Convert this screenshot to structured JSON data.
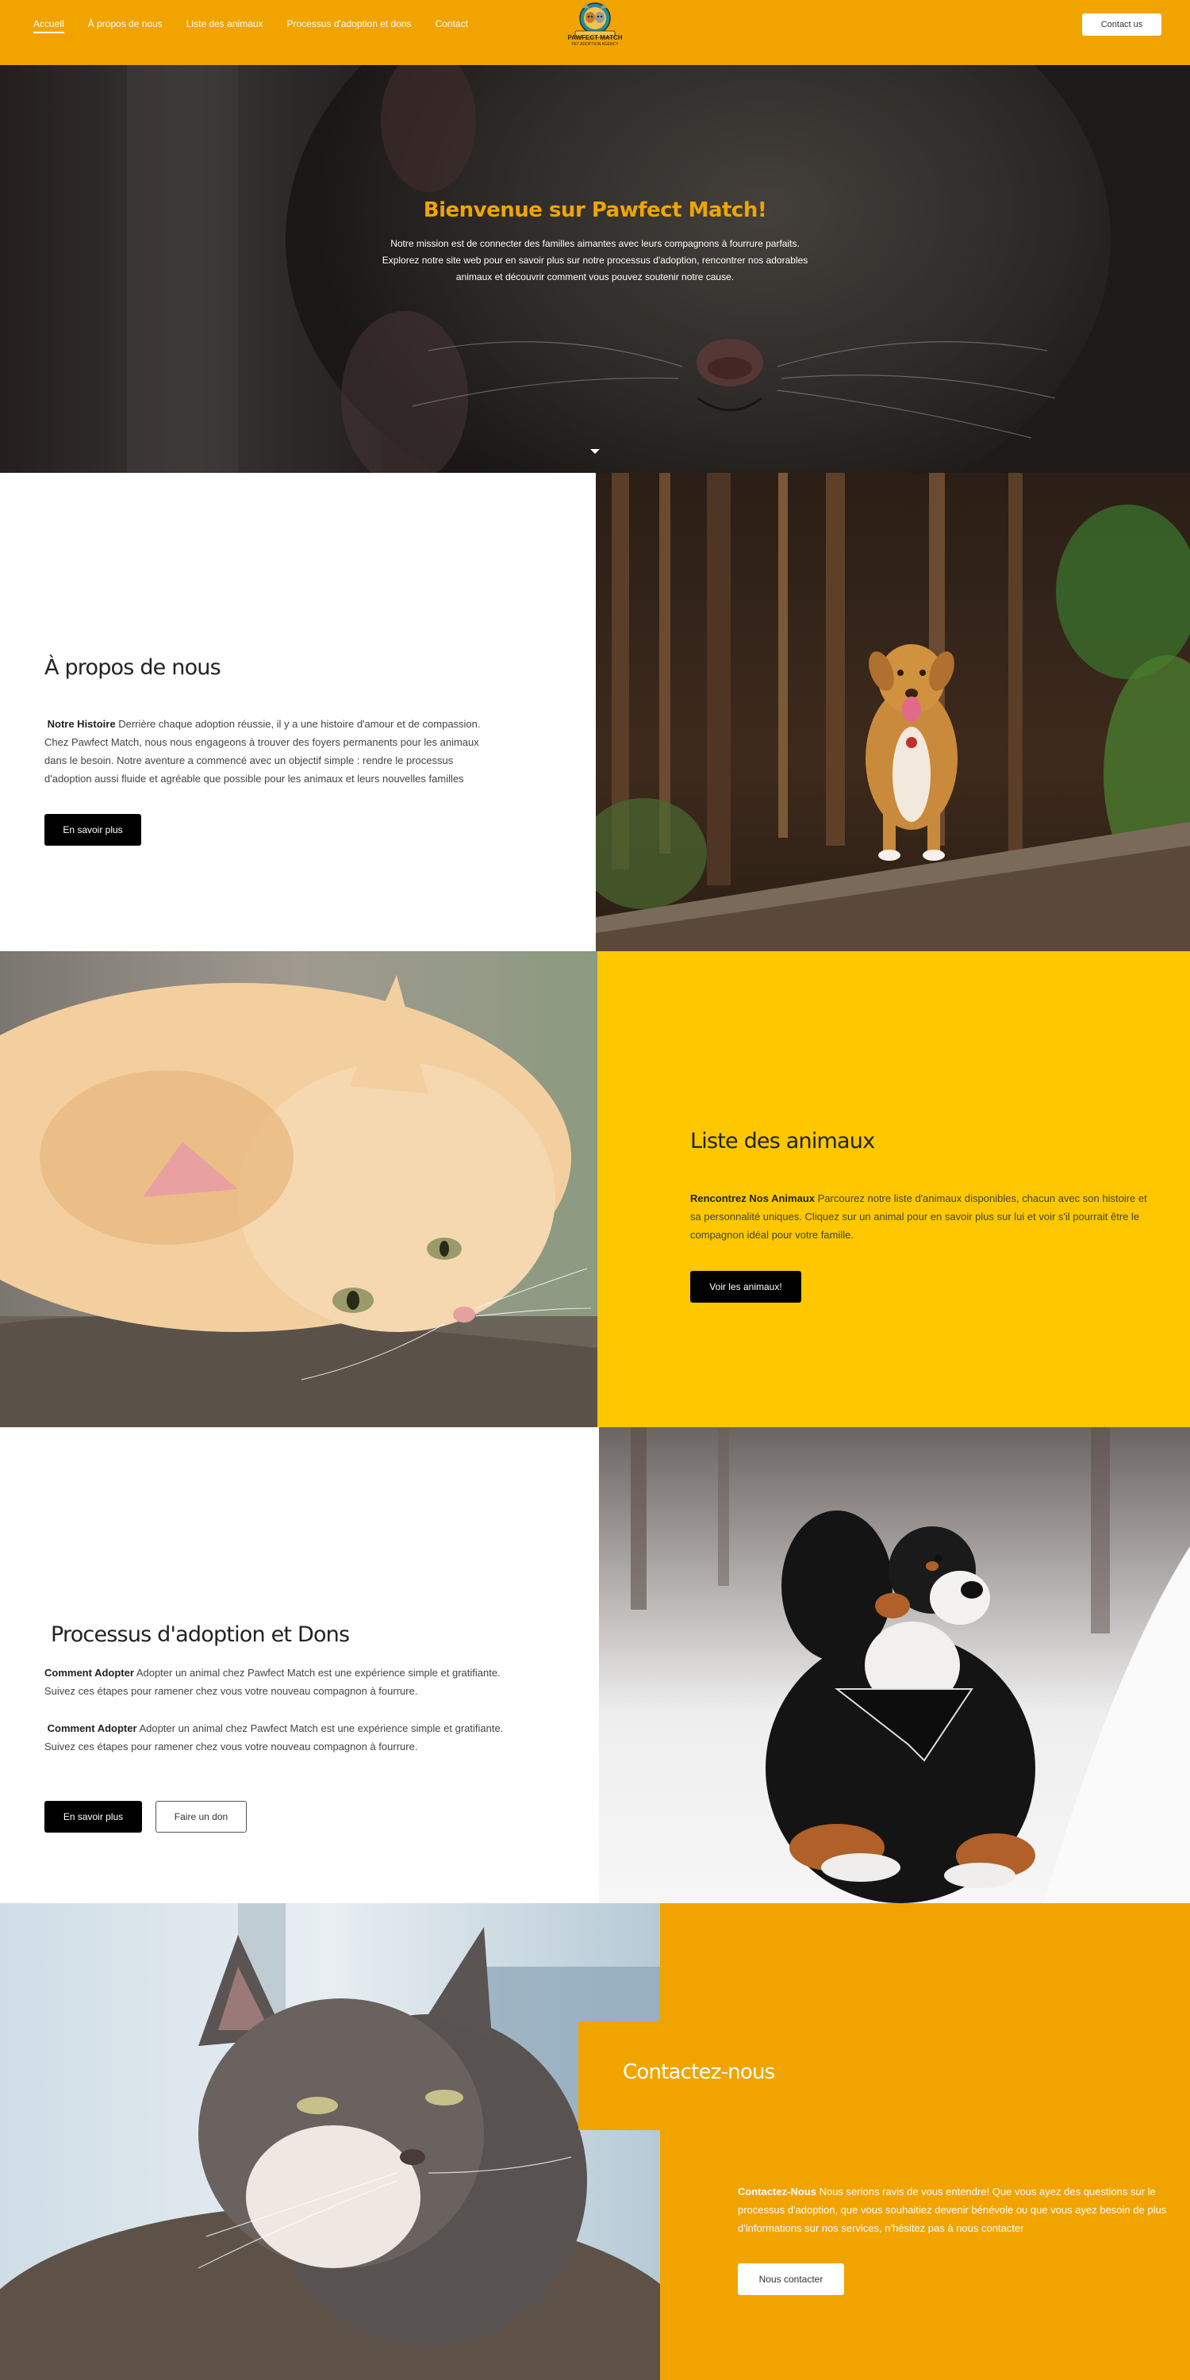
{
  "header": {
    "nav": [
      "Accueil",
      "À propos de nous",
      "Liste des animaux",
      "Processus d'adoption et dons",
      "Contact"
    ],
    "logo_text": "PAWFECT MATCH",
    "logo_subtext": "PET ADOPTION AGENCY",
    "contact_button": "Contact us"
  },
  "hero": {
    "title": "Bienvenue sur Pawfect Match!",
    "text": "Notre mission est de connecter des familles aimantes avec leurs compagnons à fourrure parfaits. Explorez notre site web pour en savoir plus sur notre processus d'adoption, rencontrer nos adorables animaux et découvrir comment vous pouvez soutenir notre cause."
  },
  "about": {
    "title": "À propos de nous",
    "lead": "Notre Histoire",
    "text": "Derrière chaque adoption réussie, il y a une histoire d'amour et de compassion. Chez Pawfect Match, nous nous engageons à trouver des foyers permanents pour les animaux dans le besoin. Notre aventure a commencé avec un objectif simple : rendre le processus d'adoption aussi fluide et agréable que possible pour les animaux et leurs nouvelles familles",
    "button": "En savoir plus"
  },
  "animals": {
    "title": "Liste des animaux",
    "lead": "Rencontrez Nos Animaux",
    "text": "Parcourez notre liste d'animaux disponibles, chacun avec son histoire et sa personnalité uniques. Cliquez sur un animal pour en savoir plus sur lui et voir s'il pourrait être le compagnon idéal pour votre famille.",
    "button": "Voir les animaux!"
  },
  "process": {
    "title": "Processus d'adoption et Dons",
    "lead1": "Comment Adopter",
    "text1": "Adopter un animal chez Pawfect Match est une expérience simple et gratifiante. Suivez ces étapes pour ramener chez vous votre nouveau compagnon à fourrure.",
    "lead2": "Comment Adopter",
    "text2": "Adopter un animal chez Pawfect Match est une expérience simple et gratifiante. Suivez ces étapes pour ramener chez vous votre nouveau compagnon à fourrure.",
    "button_primary": "En savoir plus",
    "button_secondary": "Faire un don"
  },
  "contact": {
    "title": "Contactez-nous",
    "lead": "Contactez-Nous",
    "text": "Nous serions ravis de vous entendre! Que vous ayez des questions sur le processus d'adoption, que vous souhaitiez devenir bénévole ou que vous ayez besoin de plus d'informations sur nos services, n'hésitez pas à nous contacter",
    "button": "Nous contacter"
  },
  "colors": {
    "header": "#f1a400",
    "animals_bg": "#fec700",
    "contact_bg": "#f1a400",
    "button": "#000000"
  }
}
